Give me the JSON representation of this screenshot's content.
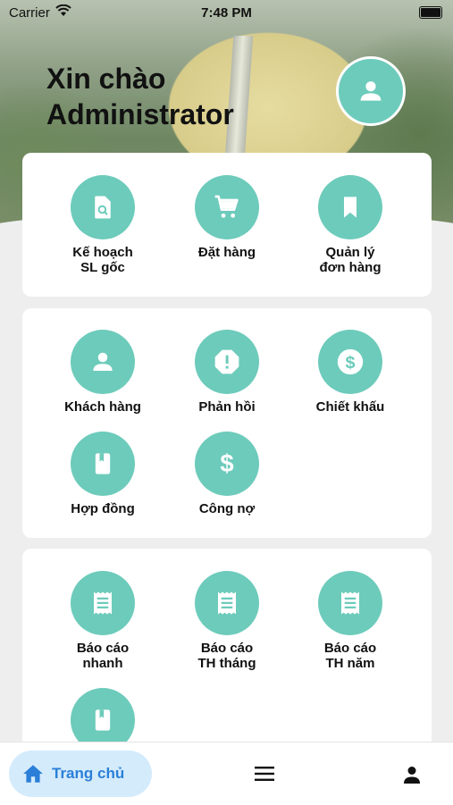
{
  "status_bar": {
    "carrier": "Carrier",
    "time": "7:48 PM"
  },
  "header": {
    "greeting_line1": "Xin chào",
    "greeting_line2": "Administrator"
  },
  "sections": [
    {
      "items": [
        {
          "label": "Kế hoạch\nSL gốc",
          "icon": "file-search-icon"
        },
        {
          "label": "Đặt hàng",
          "icon": "cart-icon"
        },
        {
          "label": "Quản lý\nđơn hàng",
          "icon": "bookmark-icon"
        }
      ]
    },
    {
      "items": [
        {
          "label": "Khách hàng",
          "icon": "person-icon"
        },
        {
          "label": "Phản hồi",
          "icon": "alert-octagon-icon"
        },
        {
          "label": "Chiết khấu",
          "icon": "dollar-circle-icon"
        },
        {
          "label": "Hợp đồng",
          "icon": "book-icon"
        },
        {
          "label": "Công nợ",
          "icon": "dollar-icon"
        }
      ]
    },
    {
      "items": [
        {
          "label": "Báo cáo\nnhanh",
          "icon": "receipt-icon"
        },
        {
          "label": "Báo cáo\nTH tháng",
          "icon": "receipt-icon"
        },
        {
          "label": "Báo cáo\nTH năm",
          "icon": "receipt-icon"
        },
        {
          "label": "",
          "icon": "book-icon"
        }
      ]
    }
  ],
  "bottom_nav": {
    "home_label": "Trang chủ",
    "active_color": "#2b7fd8"
  },
  "colors": {
    "accent": "#6dcbbb",
    "background": "#eeeeee",
    "card": "#ffffff"
  }
}
